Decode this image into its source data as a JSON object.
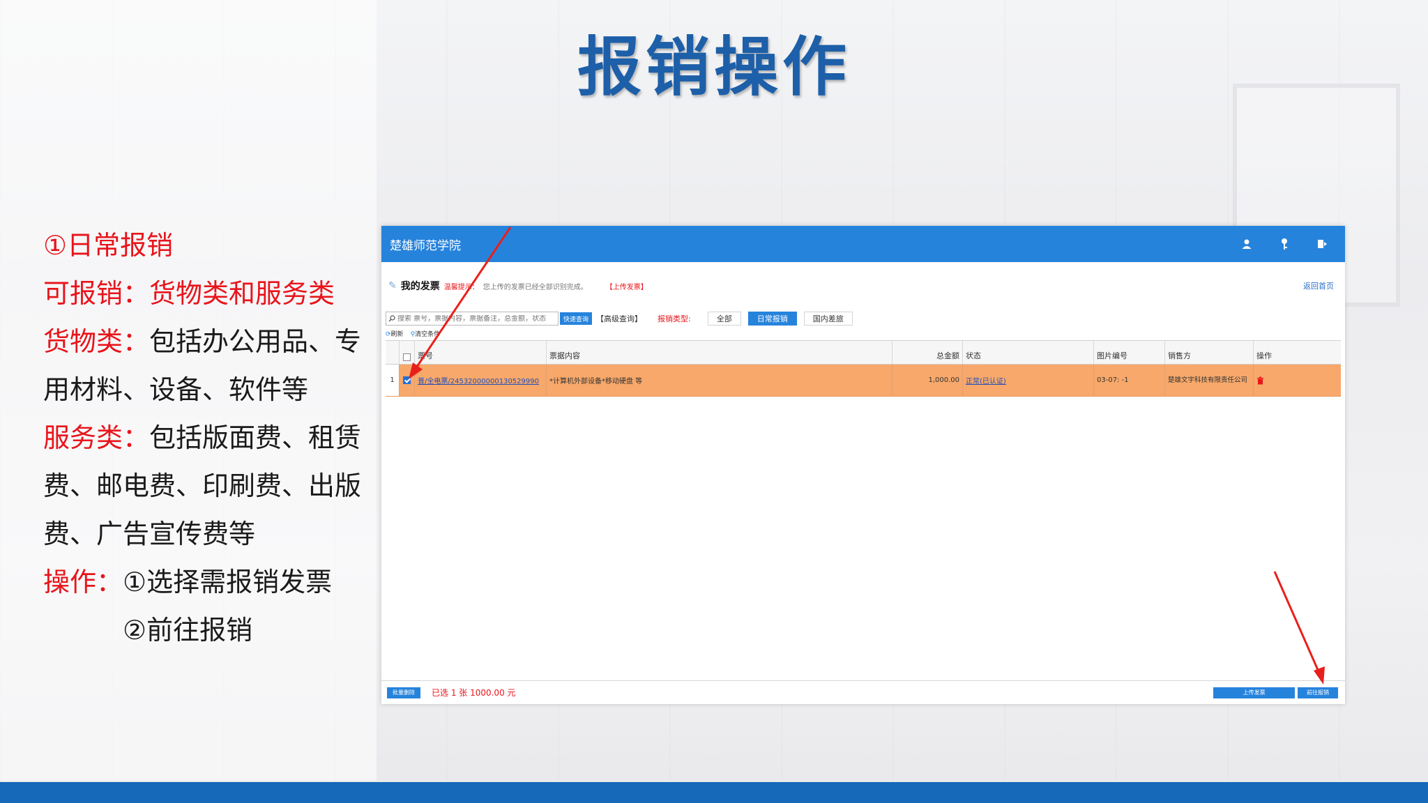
{
  "slide": {
    "title": "报销操作"
  },
  "left_panel": {
    "line1_red": "①日常报销",
    "line2_red": "可报销：货物类和服务类",
    "line3_red": "货物类：",
    "line3_black": "包括办公用品、专",
    "line4_black": "用材料、设备、软件等",
    "line5_red": "服务类：",
    "line5_black": "包括版面费、租赁",
    "line6_black": "费、邮电费、印刷费、出版",
    "line7_black": "费、广告宣传费等",
    "line8_red": "操作：",
    "line8_black": "①选择需报销发票",
    "line9_black": "②前往报销"
  },
  "app": {
    "header_title": "楚雄师范学院",
    "header_icons": [
      "user-icon",
      "key-icon",
      "logout-icon"
    ],
    "subhead": {
      "title": "我的发票",
      "tip_label": "温馨提示：",
      "tip_text": "您上传的发票已经全部识别完成。",
      "upload_link": "【上传发票】"
    },
    "home_link": "返回首页",
    "search": {
      "placeholder": "搜索 票号，票据内容，票据备注，总金额，状态",
      "quick_label": "快速查询",
      "advanced_label": "【高级查询】"
    },
    "type_label": "报销类型:",
    "type_tabs": [
      "全部",
      "日常报销",
      "国内差旅"
    ],
    "toolbar2": {
      "refresh": "刷新",
      "clear": "清空条件"
    },
    "columns": [
      "票号",
      "票据内容",
      "总金额",
      "状态",
      "图片编号",
      "销售方",
      "操作"
    ],
    "rows": [
      {
        "index": "1",
        "invoice_no": "普/全电票/24532000000130529990",
        "content": "*计算机外部设备*移动硬盘 等",
        "total": "1,000.00",
        "status": "正常(已认证)",
        "image_no": "03-07: -1",
        "seller": "楚雄文宇科技有限责任公司"
      }
    ],
    "footer": {
      "batch_delete": "批量删除",
      "selected_summary": "已选 1 张 1000.00 元",
      "upload_invoice": "上传发票",
      "go_reimburse": "前往报销"
    }
  },
  "colors": {
    "title_blue": "#1d5fa8",
    "header_blue": "#2683dc",
    "accent_red": "#e8141b",
    "row_selected": "#f7a86a",
    "bottom_bar": "#1668b8"
  }
}
